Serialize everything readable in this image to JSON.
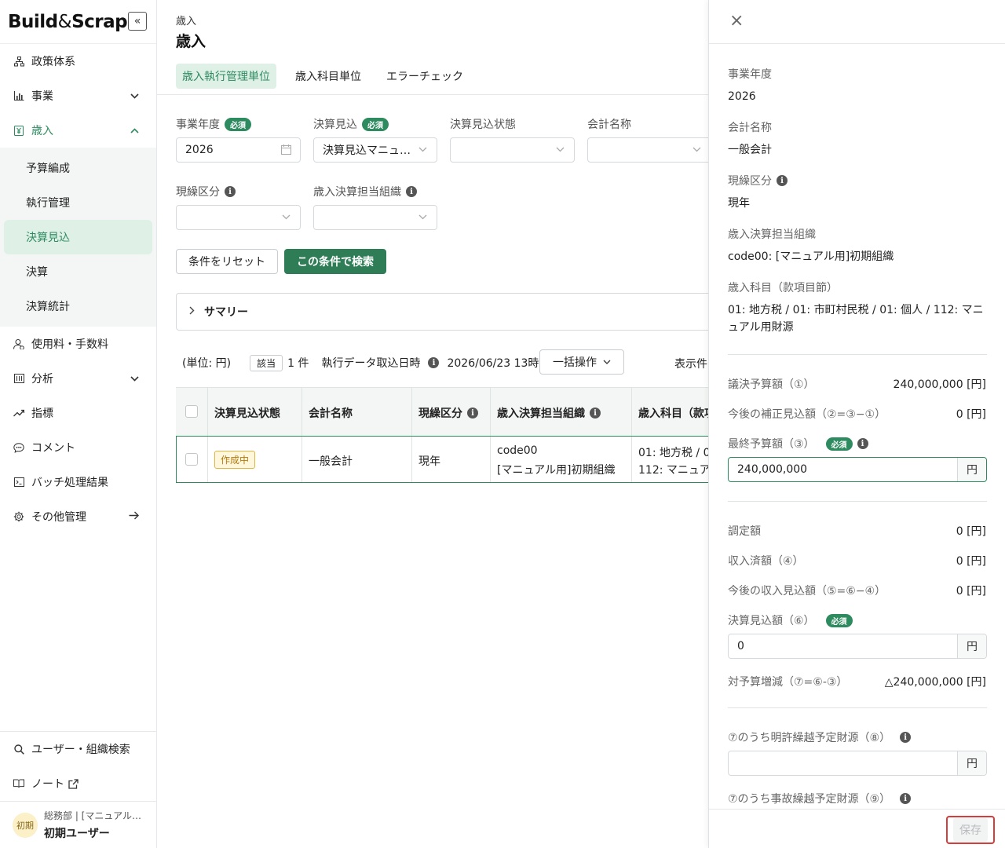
{
  "sidebar": {
    "logo_build": "Build",
    "logo_amp": "&",
    "logo_scrap": "Scrap",
    "collapse_icon": "«",
    "nav": [
      {
        "label": "政策体系",
        "icon": "hierarchy-icon"
      },
      {
        "label": "事業",
        "icon": "bar-chart-icon"
      },
      {
        "label": "歳入",
        "icon": "yen-doc-icon"
      },
      {
        "label": "使用料・手数料",
        "icon": "user-fee-icon"
      },
      {
        "label": "分析",
        "icon": "analysis-icon"
      },
      {
        "label": "指標",
        "icon": "trend-icon"
      },
      {
        "label": "コメント",
        "icon": "comment-icon"
      },
      {
        "label": "バッチ処理結果",
        "icon": "terminal-icon"
      },
      {
        "label": "その他管理",
        "icon": "gear-icon"
      }
    ],
    "subnav": [
      "予算編成",
      "執行管理",
      "決算見込",
      "決算",
      "決算統計"
    ],
    "bottom": [
      {
        "label": "ユーザー・組織検索",
        "icon": "search-icon"
      },
      {
        "label": "ノート",
        "icon": "note-icon"
      }
    ],
    "user": {
      "avatar": "初期",
      "dept": "総務部 | [マニュアル…",
      "name": "初期ユーザー"
    }
  },
  "main": {
    "breadcrumb": "歳入",
    "title": "歳入",
    "tabs": [
      "歳入執行管理単位",
      "歳入科目単位",
      "エラーチェック"
    ],
    "filters": {
      "fiscal_year_label": "事業年度",
      "fiscal_year_value": "2026",
      "settlement_label": "決算見込",
      "settlement_value": "決算見込マニュ…",
      "settlement_status_label": "決算見込状態",
      "account_label": "会計名称",
      "cash_label": "現繰区分",
      "org_label": "歳入決算担当組織",
      "required": "必須"
    },
    "reset_button": "条件をリセット",
    "search_button": "この条件で検索",
    "summary": "サマリー",
    "toolbar": {
      "unit": "(単位: 円)",
      "hit_chip": "該当",
      "count": "1 件",
      "import_label": "執行データ取込日時",
      "import_value": "2026/06/23 13時",
      "bulk": "一括操作",
      "display": "表示件"
    },
    "table": {
      "headers": [
        "決算見込状態",
        "会計名称",
        "現繰区分",
        "歳入決算担当組織",
        "歳入科目（款項"
      ],
      "row": {
        "status": "作成中",
        "account": "一般会計",
        "cash": "現年",
        "org_line1": "code00",
        "org_line2": "[マニュアル用]初期組織",
        "subject_line1": "01: 地方税 / 01",
        "subject_line2": "112: マニュア"
      }
    }
  },
  "panel": {
    "fiscal_year_label": "事業年度",
    "fiscal_year": "2026",
    "account_label": "会計名称",
    "account": "一般会計",
    "cash_label": "現繰区分",
    "cash": "現年",
    "org_label": "歳入決算担当組織",
    "org": "code00: [マニュアル用]初期組織",
    "subject_label": "歳入科目（款項目節）",
    "subject": "01: 地方税 / 01: 市町村民税 / 01: 個人 / 112: マニュアル用財源",
    "resolved_label": "議決予算額（①）",
    "resolved": "240,000,000 [円]",
    "future_corr_label": "今後の補正見込額（②=③−①）",
    "future_corr": "0 [円]",
    "final_label": "最終予算額（③）",
    "final_value": "240,000,000",
    "yen": "円",
    "required": "必須",
    "assessed_label": "調定額",
    "assessed": "0 [円]",
    "received_label": "収入済額（④）",
    "received": "0 [円]",
    "future_income_label": "今後の収入見込額（⑤=⑥−④）",
    "future_income": "0 [円]",
    "settle_label": "決算見込額（⑥）",
    "settle_value": "0",
    "diff_label": "対予算増減（⑦=⑥-③）",
    "diff": "△240,000,000 [円]",
    "carry_label": "⑦のうち明許繰越予定財源（⑧）",
    "carry_value": "",
    "accident_label": "⑦のうち事故繰越予定財源（⑨）",
    "save": "保存",
    "close_icon": "×"
  },
  "colors": {
    "accent": "#2e8a5f",
    "primary_button": "#2e7d57",
    "save_highlight": "#d63c3c"
  }
}
